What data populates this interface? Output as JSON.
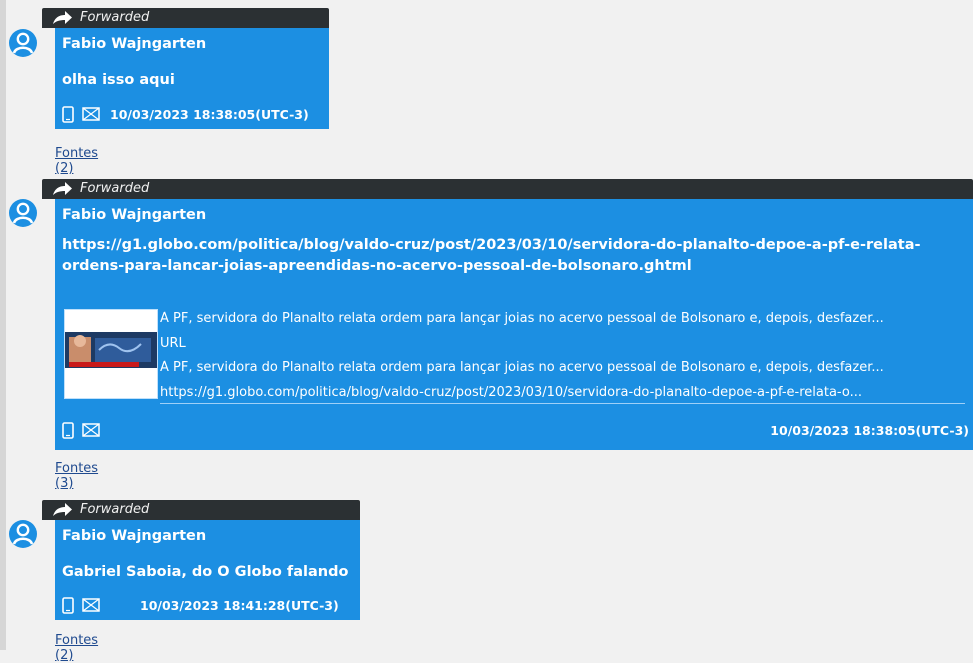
{
  "messages": [
    {
      "forward_label": "Forwarded",
      "sender": "Fabio  Wajngarten",
      "text": "olha isso aqui",
      "timestamp": "10/03/2023 18:38:05(UTC-3)",
      "sources": "Fontes (2)"
    },
    {
      "forward_label": "Forwarded",
      "sender": "Fabio  Wajngarten",
      "url": "https://g1.globo.com/politica/blog/valdo-cruz/post/2023/03/10/servidora-do-planalto-depoe-a-pf-e-relata-ordens-para-lancar-joias-apreendidas-no-acervo-pessoal-de-bolsonaro.ghtml",
      "preview": {
        "title": "À PF, servidora do Planalto relata ordem para lançar joias no acervo pessoal de Bolsonaro e, depois, desfazer...",
        "type_label": "URL",
        "description": "À PF, servidora do Planalto relata ordem para lançar joias no acervo pessoal de Bolsonaro e, depois, desfazer...",
        "link": "https://g1.globo.com/politica/blog/valdo-cruz/post/2023/03/10/servidora-do-planalto-depoe-a-pf-e-relata-o..."
      },
      "timestamp": "10/03/2023 18:38:05(UTC-3)",
      "sources": "Fontes (3)"
    },
    {
      "forward_label": "Forwarded",
      "sender": "Fabio  Wajngarten",
      "text": "Gabriel Saboia, do O Globo falando",
      "timestamp": "10/03/2023 18:41:28(UTC-3)",
      "sources": "Fontes (2)"
    }
  ],
  "colors": {
    "bubble": "#1c8fe2",
    "forward_bar": "#2b3033",
    "link": "#1f4a8f",
    "background": "#f1f1f1"
  },
  "icons": [
    "avatar-icon",
    "forward-arrow-icon",
    "phone-icon",
    "mail-icon"
  ]
}
